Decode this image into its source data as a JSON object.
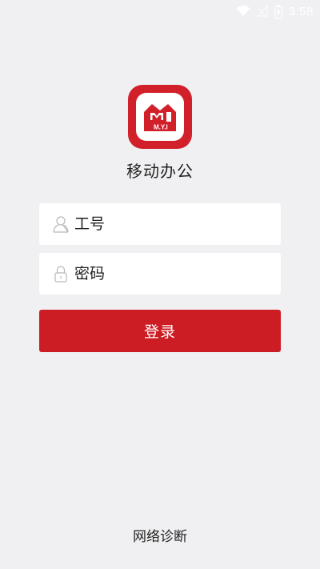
{
  "status_bar": {
    "time": "3:58",
    "icons": [
      "wifi-icon",
      "signal-icon",
      "battery-icon"
    ]
  },
  "logo": {
    "text": "M.Y.I",
    "colors": {
      "brand": "#d2202b",
      "inner": "#ffffff"
    }
  },
  "app": {
    "title": "移动办公"
  },
  "form": {
    "username_placeholder": "工号",
    "password_placeholder": "密码",
    "login_label": "登录"
  },
  "footer": {
    "diagnose_label": "网络诊断"
  },
  "colors": {
    "primary": "#cc1c24",
    "background": "#f0f0f2"
  }
}
